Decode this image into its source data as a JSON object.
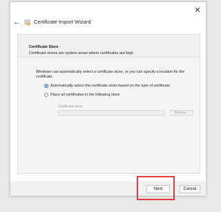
{
  "window": {
    "title": "Certificate Import Wizard",
    "close_label": "✕",
    "back_label": "←"
  },
  "header": {
    "title": "Certificate Store",
    "subtitle": "Certificate stores are system areas where certificates are kept."
  },
  "body": {
    "intro": "Windows can automatically select a certificate store, or you can specify a location for the certificate.",
    "options": [
      {
        "label": "Automatically select the certificate store based on the type of certificate",
        "selected": true
      },
      {
        "label": "Place all certificates in the following store",
        "selected": false
      }
    ],
    "store_label": "Certificate store:",
    "store_value": "",
    "browse_label": "Browse..."
  },
  "footer": {
    "next_label": "Next",
    "cancel_label": "Cancel"
  },
  "colors": {
    "accent": "#1f5fbf",
    "highlight": "#e23a3a"
  },
  "icons": {
    "back": "back-arrow-icon",
    "app": "certificate-icon",
    "close": "close-icon"
  }
}
